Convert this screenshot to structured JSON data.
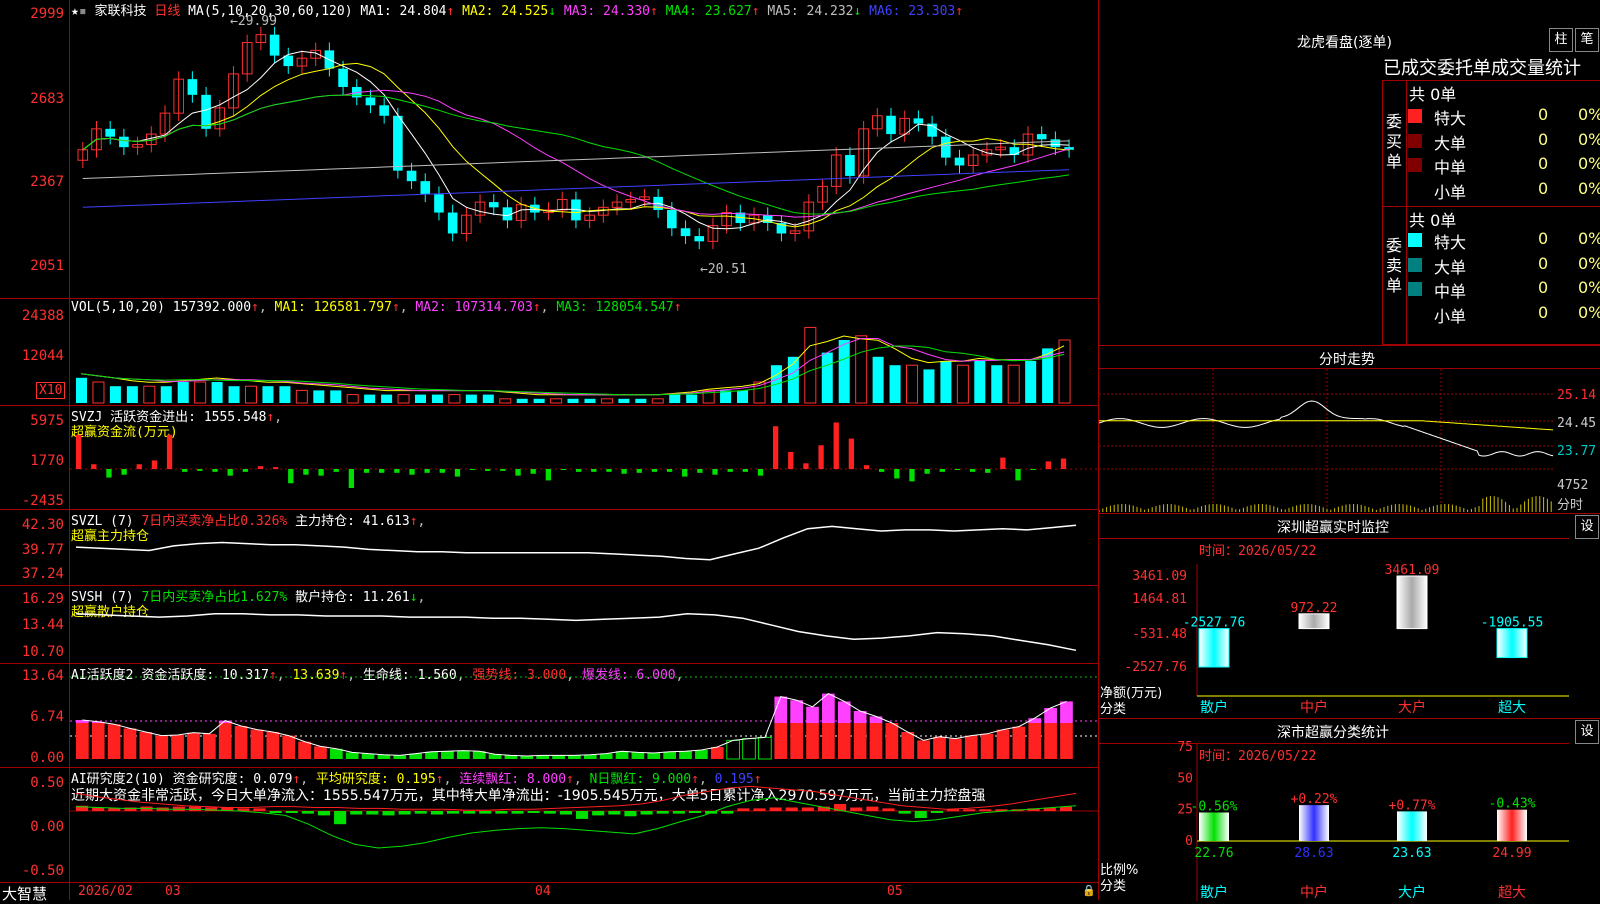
{
  "stock": {
    "name": "家联科技",
    "period": "日线",
    "ma_spec": "MA(5,10,20,30,60,120)"
  },
  "kline": {
    "ma_values": [
      {
        "name": "MA1",
        "value": "24.804",
        "arrow": "↑",
        "color": "#ffffff"
      },
      {
        "name": "MA2",
        "value": "24.525",
        "arrow": "↓",
        "color": "#ffff00"
      },
      {
        "name": "MA3",
        "value": "24.330",
        "arrow": "↑",
        "color": "#ff40ff"
      },
      {
        "name": "MA4",
        "value": "23.627",
        "arrow": "↑",
        "color": "#00e000"
      },
      {
        "name": "MA5",
        "value": "24.232",
        "arrow": "↓",
        "color": "#c0c0c0"
      },
      {
        "name": "MA6",
        "value": "23.303",
        "arrow": "↑",
        "color": "#4040ff"
      }
    ],
    "y_ticks": [
      "2999",
      "2683",
      "2367",
      "2051"
    ],
    "high_label": "29.99",
    "low_label": "20.51"
  },
  "vol": {
    "spec": "VOL(5,10,20)",
    "value": "157392.000",
    "arrow": "↑",
    "ma1": "126581.797",
    "ma2": "107314.703",
    "ma3": "128054.547",
    "y_ticks": [
      "24388",
      "12044"
    ],
    "unit": "X10"
  },
  "svzj": {
    "name": "SVZJ",
    "label": "活跃资金进出",
    "value": "1555.548",
    "arrow": "↑",
    "subtitle": "超赢资金流(万元)",
    "y_ticks": [
      "5975",
      "1770",
      "-2435"
    ]
  },
  "svzl": {
    "name": "SVZL",
    "param": "(7)",
    "ratio_label": "7日内买卖净占比",
    "ratio": "0.326%",
    "hold_label": "主力持仓",
    "hold": "41.613",
    "arrow": "↑",
    "subtitle": "超赢主力持仓",
    "y_ticks": [
      "42.30",
      "39.77",
      "37.24"
    ]
  },
  "svsh": {
    "name": "SVSH",
    "param": "(7)",
    "ratio_label": "7日内买卖净占比",
    "ratio": "1.627%",
    "hold_label": "散户持仓",
    "hold": "11.261",
    "arrow": "↓",
    "subtitle": "超赢散户持仓",
    "y_ticks": [
      "16.29",
      "13.44",
      "10.70"
    ]
  },
  "ai_active": {
    "name": "AI活跃度2",
    "label": "资金活跃度",
    "v1": "10.317",
    "v2": "13.639",
    "life_label": "生命线",
    "life": "1.560",
    "strong_label": "强势线",
    "strong": "3.000",
    "burst_label": "爆发线",
    "burst": "6.000",
    "y_ticks": [
      "13.64",
      "6.74",
      "0.00"
    ]
  },
  "ai_research": {
    "name": "AI研究度2(10)",
    "label": "资金研究度",
    "v1": "0.079",
    "avg_label": "平均研究度",
    "avg": "0.195",
    "cont_label": "连续飘红",
    "cont": "8.000",
    "n_label": "N日飘红",
    "n": "9.000",
    "v5": "0.195",
    "summary": "近期大资金非常活跃，今日大单净流入：1555.547万元，其中特大单净流出：-1905.545万元，大单5日累计净入2970.597万元，当前主力控盘强",
    "y_ticks": [
      "0.50",
      "0.00",
      "-0.50"
    ]
  },
  "xaxis": {
    "brand": "大智慧",
    "labels": [
      "2026/02",
      "03",
      "04",
      "05"
    ]
  },
  "longhu": {
    "title": "龙虎看盘(逐单)",
    "btn_zhu": "柱",
    "btn_bi": "笔",
    "subtitle": "已成交委托单成交量统计",
    "buy": {
      "side": "委买单",
      "total": "共 0单",
      "rows": [
        {
          "label": "特大",
          "n": "0",
          "p": "0%"
        },
        {
          "label": "大单",
          "n": "0",
          "p": "0%"
        },
        {
          "label": "中单",
          "n": "0",
          "p": "0%"
        },
        {
          "label": "小单",
          "n": "0",
          "p": "0%"
        }
      ]
    },
    "sell": {
      "side": "委卖单",
      "total": "共 0单",
      "rows": [
        {
          "label": "特大",
          "n": "0",
          "p": "0%"
        },
        {
          "label": "大单",
          "n": "0",
          "p": "0%"
        },
        {
          "label": "中单",
          "n": "0",
          "p": "0%"
        },
        {
          "label": "小单",
          "n": "0",
          "p": "0%"
        }
      ]
    }
  },
  "intraday": {
    "title": "分时走势",
    "right_ticks": [
      "25.14",
      "24.45",
      "23.77",
      "4752"
    ],
    "bottom_label": "分时"
  },
  "monitor": {
    "title": "深圳超赢实时监控",
    "btn": "设",
    "time_label": "时间：2026/05/22",
    "y_ticks": [
      "3461.09",
      "1464.81",
      "-531.48",
      "-2527.76"
    ],
    "ylabel": "净额(万元)",
    "xlabel": "分类",
    "bars": [
      {
        "cat": "散户",
        "value": "-2527.76"
      },
      {
        "cat": "中户",
        "value": "972.22"
      },
      {
        "cat": "大户",
        "value": "3461.09"
      },
      {
        "cat": "超大",
        "value": "-1905.55"
      }
    ]
  },
  "classify": {
    "title": "深市超赢分类统计",
    "btn": "设",
    "time_label": "时间：2026/05/22",
    "y_ticks": [
      "75",
      "50",
      "25",
      "0"
    ],
    "ylabel": "比例%",
    "xlabel": "分类",
    "bars": [
      {
        "cat": "散户",
        "value": "22.76",
        "change": "-0.56%"
      },
      {
        "cat": "中户",
        "value": "28.63",
        "change": "+0.22%"
      },
      {
        "cat": "大户",
        "value": "23.63",
        "change": "+0.77%"
      },
      {
        "cat": "超大",
        "value": "24.99",
        "change": "-0.43%"
      }
    ]
  },
  "chart_data": [
    {
      "type": "candlestick",
      "title": "家联科技 日线",
      "ylim": [
        20.51,
        29.99
      ],
      "series_close": [
        24.8,
        25.6,
        25.3,
        24.9,
        25.0,
        25.4,
        26.2,
        27.5,
        26.9,
        25.6,
        26.4,
        27.7,
        28.9,
        29.2,
        28.4,
        28.0,
        28.3,
        28.6,
        27.9,
        27.2,
        26.8,
        26.5,
        26.1,
        24.0,
        23.6,
        23.1,
        22.4,
        21.6,
        22.3,
        22.8,
        22.6,
        22.1,
        22.7,
        22.4,
        22.5,
        22.9,
        22.1,
        22.3,
        22.6,
        22.8,
        22.9,
        23.0,
        22.5,
        21.8,
        21.5,
        21.3,
        21.9,
        22.4,
        22.0,
        22.3,
        22.0,
        21.6,
        21.7,
        22.8,
        23.4,
        24.6,
        23.8,
        25.6,
        26.1,
        25.4,
        26.0,
        25.8,
        25.3,
        24.5,
        24.2,
        24.6,
        24.8,
        24.9,
        24.6,
        25.4,
        25.2,
        24.9,
        24.8
      ],
      "ma_series": [
        {
          "name": "MA1"
        },
        {
          "name": "MA2"
        },
        {
          "name": "MA3"
        },
        {
          "name": "MA4"
        },
        {
          "name": "MA5"
        },
        {
          "name": "MA6"
        }
      ]
    },
    {
      "type": "bar",
      "title": "VOL",
      "values": [
        6,
        5,
        4,
        4,
        4,
        4,
        5,
        5,
        5,
        4,
        4,
        4,
        4,
        3,
        3,
        3,
        2,
        2,
        2,
        2,
        2,
        2,
        2,
        2,
        2,
        1,
        1,
        1,
        1,
        1,
        1,
        1,
        1,
        1,
        1,
        2,
        2,
        3,
        3,
        3,
        5,
        9,
        11,
        18,
        12,
        15,
        16,
        11,
        9,
        9,
        8,
        10,
        9,
        10,
        9,
        9,
        10,
        13,
        15
      ]
    },
    {
      "type": "bar",
      "title": "SVZJ",
      "values": [
        3.6,
        0.5,
        -0.9,
        -0.6,
        0.5,
        0.9,
        3.6,
        -0.3,
        -0.2,
        -0.3,
        -0.7,
        -0.3,
        0.3,
        0.2,
        -1.5,
        -0.6,
        -0.7,
        -0.3,
        -2.0,
        -0.4,
        -0.4,
        -0.4,
        -0.6,
        -0.4,
        -0.4,
        -0.8,
        -0.1,
        -0.2,
        -0.2,
        -0.7,
        -0.5,
        -1.2,
        -0.1,
        -0.3,
        -0.3,
        -0.3,
        -0.5,
        -0.4,
        -0.3,
        -0.3,
        -0.8,
        -0.4,
        -0.6,
        -0.3,
        -0.3,
        -0.7,
        4.5,
        1.8,
        0.6,
        2.5,
        4.9,
        3.2,
        0.4,
        -0.3,
        -1.0,
        -1.3,
        -0.5,
        -0.3,
        -0.1,
        -0.3,
        -0.4,
        1.2,
        -1.2,
        -0.1,
        0.8,
        1.1
      ]
    },
    {
      "type": "bar",
      "title": "AI活跃度2",
      "values": [
        6.5,
        6.2,
        5.8,
        5.1,
        4.5,
        3.9,
        4.0,
        4.4,
        4.2,
        6.4,
        5.5,
        4.9,
        4.5,
        3.9,
        2.9,
        2.1,
        1.7,
        1.1,
        0.9,
        0.7,
        0.6,
        0.9,
        1.2,
        1.3,
        1.4,
        1.3,
        0.8,
        0.6,
        0.5,
        0.6,
        0.6,
        0.6,
        0.7,
        0.9,
        1.3,
        1.1,
        1.0,
        1.2,
        1.3,
        1.5,
        2.0,
        3.1,
        3.4,
        3.6,
        10.4,
        9.8,
        8.7,
        10.9,
        9.6,
        8.0,
        7.1,
        6.0,
        4.5,
        3.1,
        3.7,
        3.4,
        3.9,
        4.2,
        4.9,
        5.4,
        6.8,
        8.5,
        9.6
      ]
    },
    {
      "type": "bar",
      "title": "深圳超赢实时监控",
      "categories": [
        "散户",
        "中户",
        "大户",
        "超大"
      ],
      "values": [
        -2527.76,
        972.22,
        3461.09,
        -1905.55
      ],
      "ylabel": "净额(万元)",
      "xlabel": "分类",
      "ylim": [
        -2527.76,
        3461.09
      ]
    },
    {
      "type": "bar",
      "title": "深市超赢分类统计",
      "categories": [
        "散户",
        "中户",
        "大户",
        "超大"
      ],
      "values": [
        22.76,
        28.63,
        23.63,
        24.99
      ],
      "ylabel": "比例%",
      "xlabel": "分类",
      "ylim": [
        0,
        75
      ]
    }
  ]
}
